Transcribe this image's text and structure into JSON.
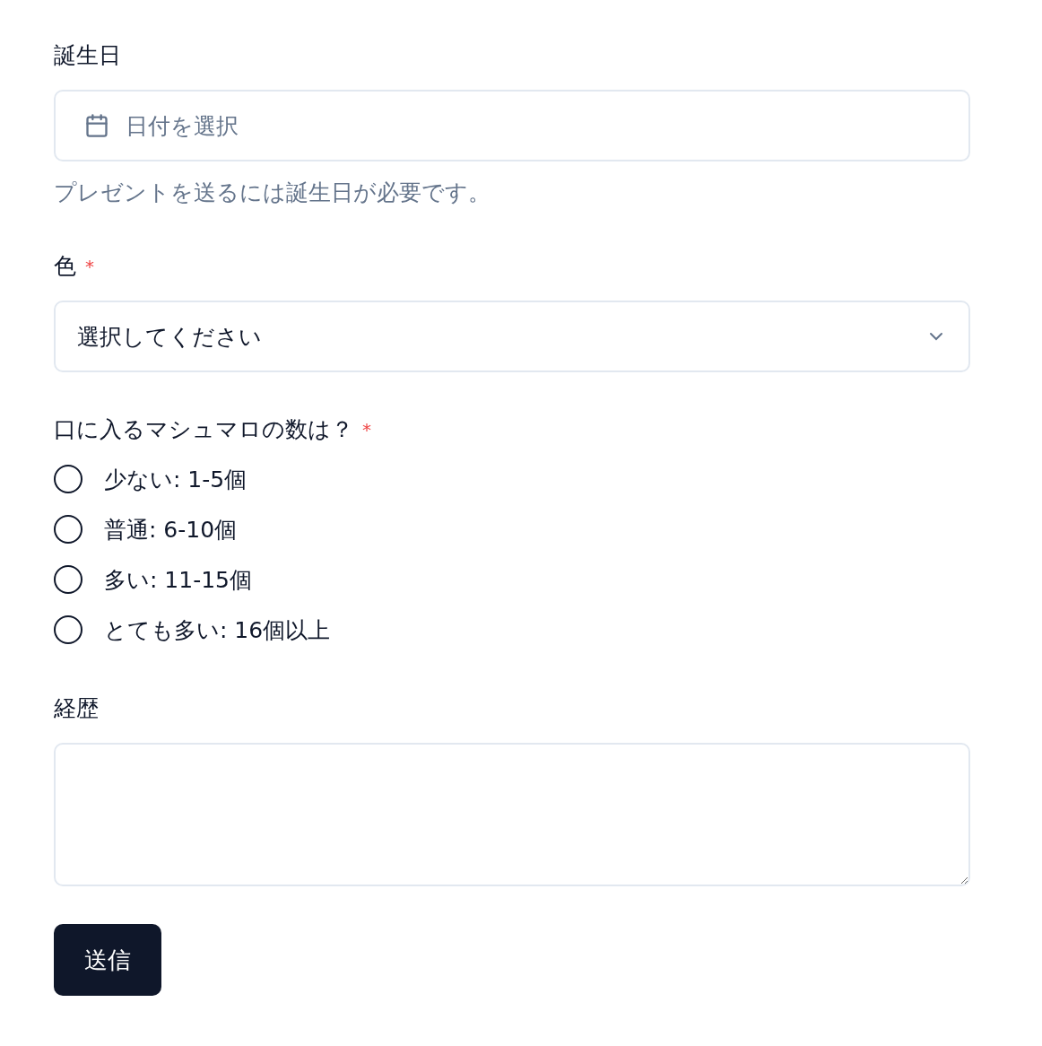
{
  "required_mark": "*",
  "fields": [
    {
      "kind": "date",
      "label": "誕生日",
      "required": false,
      "placeholder": "日付を選択",
      "description": "プレゼントを送るには誕生日が必要です。"
    },
    {
      "kind": "select",
      "label": "色",
      "required": true,
      "placeholder": "選択してください"
    },
    {
      "kind": "radio",
      "label": "口に入るマシュマロの数は？",
      "required": true,
      "options": [
        {
          "label": "少ない: 1-5個",
          "selected": false
        },
        {
          "label": "普通: 6-10個",
          "selected": false
        },
        {
          "label": "多い: 11-15個",
          "selected": false
        },
        {
          "label": "とても多い: 16個以上",
          "selected": false
        }
      ]
    },
    {
      "kind": "textarea",
      "label": "経歴",
      "required": false
    }
  ],
  "submit": "送信"
}
